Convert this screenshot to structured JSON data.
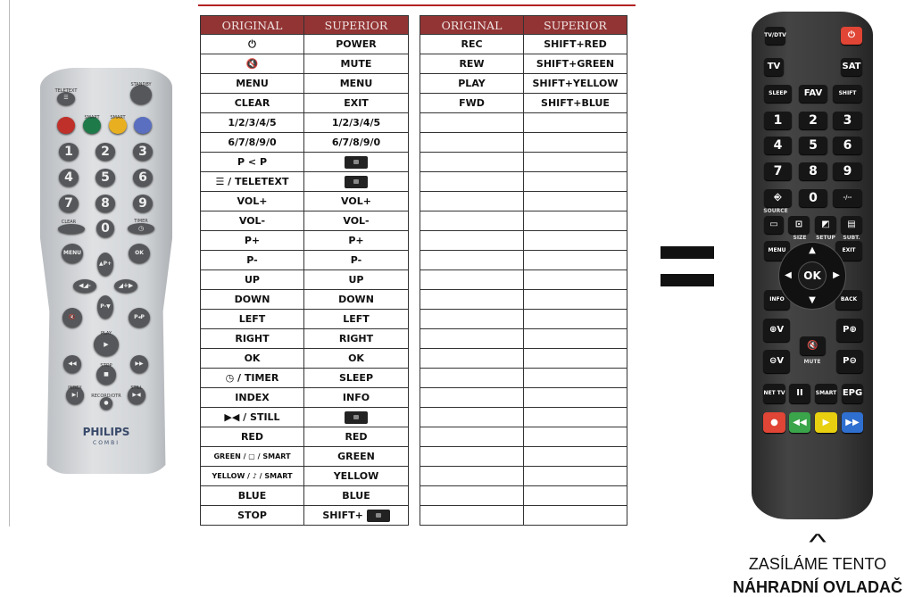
{
  "left_table": {
    "headers": [
      "ORIGINAL",
      "SUPERIOR"
    ],
    "rows": [
      [
        "⏻",
        "POWER"
      ],
      [
        "🔇",
        "MUTE"
      ],
      [
        "MENU",
        "MENU"
      ],
      [
        "CLEAR",
        "EXIT"
      ],
      [
        "1/2/3/4/5",
        "1/2/3/4/5"
      ],
      [
        "6/7/8/9/0",
        "6/7/8/9/0"
      ],
      [
        "P < P",
        "[key]"
      ],
      [
        "☰ / TELETEXT",
        "[key]"
      ],
      [
        "VOL+",
        "VOL+"
      ],
      [
        "VOL-",
        "VOL-"
      ],
      [
        "P+",
        "P+"
      ],
      [
        "P-",
        "P-"
      ],
      [
        "UP",
        "UP"
      ],
      [
        "DOWN",
        "DOWN"
      ],
      [
        "LEFT",
        "LEFT"
      ],
      [
        "RIGHT",
        "RIGHT"
      ],
      [
        "OK",
        "OK"
      ],
      [
        "◷ / TIMER",
        "SLEEP"
      ],
      [
        "INDEX",
        "INFO"
      ],
      [
        "▶◀ / STILL",
        "[key]"
      ],
      [
        "RED",
        "RED"
      ],
      [
        "GREEN / ▢ / SMART",
        "GREEN"
      ],
      [
        "YELLOW / ♪ / SMART",
        "YELLOW"
      ],
      [
        "BLUE",
        "BLUE"
      ],
      [
        "STOP",
        "SHIFT+"
      ]
    ]
  },
  "right_table": {
    "headers": [
      "ORIGINAL",
      "SUPERIOR"
    ],
    "rows": [
      [
        "REC",
        "SHIFT+RED"
      ],
      [
        "REW",
        "SHIFT+GREEN"
      ],
      [
        "PLAY",
        "SHIFT+YELLOW"
      ],
      [
        "FWD",
        "SHIFT+BLUE"
      ]
    ],
    "empty_rows": 21
  },
  "original_remote": {
    "brand": "PHILIPS",
    "model": "COMBI",
    "labels": [
      "TELETEXT",
      "STANDBY",
      "SMART",
      "SMART",
      "CLEAR",
      "TIMER",
      "PLAY",
      "STOP",
      "INDEX",
      "STILL",
      "RECORD/OTR"
    ],
    "buttons": [
      "☰",
      "",
      "",
      "",
      "",
      "",
      "1",
      "2",
      "3",
      "4",
      "5",
      "6",
      "7",
      "8",
      "9",
      "",
      "0",
      "◷",
      "MENU",
      "OK",
      "▲P+",
      "◀◢-",
      "◢+▶",
      "P-▼",
      "🔇",
      "P◂P",
      "▶",
      "◀◀",
      "▶▶",
      "■",
      "▶|",
      "▶◀",
      "●"
    ],
    "colors": {
      "red": "#c0302a",
      "green": "#1f7a4a",
      "yellow": "#e8b020",
      "blue": "#5a6fc0"
    }
  },
  "superior_remote": {
    "buttons": [
      "TV/DTV",
      "⏻",
      "TV",
      "SAT",
      "SLEEP",
      "FAV",
      "SHIFT",
      "1",
      "2",
      "3",
      "4",
      "5",
      "6",
      "7",
      "8",
      "9",
      "⎆",
      "0",
      "-/--",
      "▭",
      "⊡",
      "◩",
      "▤",
      "MENU",
      "EXIT",
      "INFO",
      "BACK",
      "⊕V",
      "P⊕",
      "🔇",
      "⊖V",
      "P⊖",
      "NET TV",
      "II",
      "SMART",
      "EPG",
      "●",
      "◀◀",
      "▶",
      "▶▶"
    ],
    "labels": [
      "SOURCE",
      "SIZE",
      "SETUP",
      "SUBT.",
      "MUTE"
    ],
    "dpad": {
      "ok": "OK",
      "up": "▲",
      "down": "▼",
      "left": "◀",
      "right": "▶"
    },
    "colors": {
      "power": "#e04535",
      "red": "#e04535",
      "green": "#3aa54a",
      "yellow": "#e8d010",
      "blue": "#2f6fd0"
    }
  },
  "equals_icon": "equals-sign",
  "cta": {
    "caret": "^",
    "line1": "ZASÍLÁME TENTO",
    "line2": "NÁHRADNÍ OVLADAČ"
  }
}
